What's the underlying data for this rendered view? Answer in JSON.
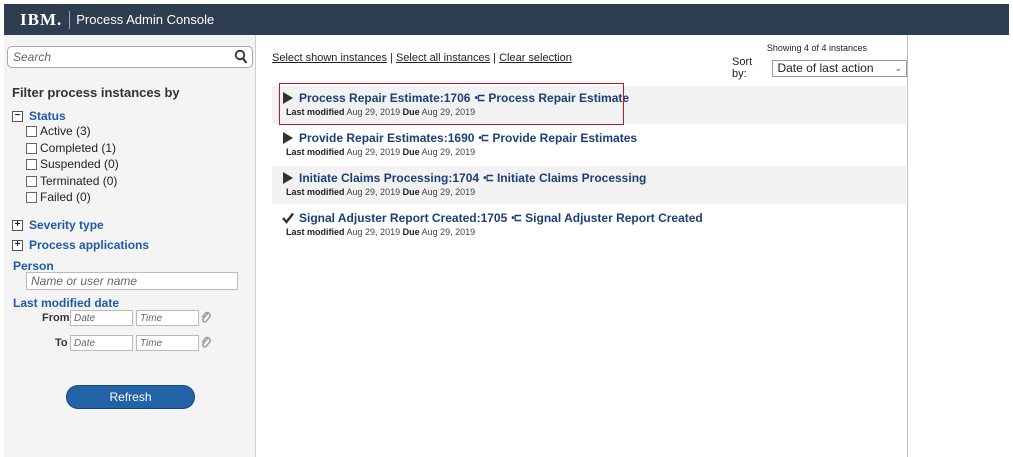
{
  "header": {
    "logo": "IBM.",
    "title": "Process Admin Console"
  },
  "sidebar": {
    "search_placeholder": "Search",
    "filter_title": "Filter process instances by",
    "status": {
      "label": "Status",
      "toggle": "−",
      "options": [
        "Active (3)",
        "Completed (1)",
        "Suspended (0)",
        "Terminated (0)",
        "Failed (0)"
      ]
    },
    "severity": {
      "label": "Severity type",
      "toggle": "+"
    },
    "process_apps": {
      "label": "Process applications",
      "toggle": "+"
    },
    "person": {
      "label": "Person",
      "placeholder": "Name or user name"
    },
    "last_modified": {
      "label": "Last modified date",
      "from_label": "From",
      "to_label": "To",
      "date_placeholder": "Date",
      "time_placeholder": "Time"
    },
    "refresh_label": "Refresh"
  },
  "main": {
    "select_shown": "Select shown instances",
    "select_all": "Select all instances",
    "clear_selection": "Clear selection",
    "separator": "|",
    "showing": "Showing 4 of 4 instances",
    "sort_label": "Sort by:",
    "sort_value": "Date of last action",
    "meta_labels": {
      "last_modified": "Last modified",
      "due": "Due"
    },
    "instances": [
      {
        "name": "Process Repair Estimate:1706",
        "process": "Process Repair Estimate",
        "last_modified": "Aug 29, 2019",
        "due": "Aug 29, 2019",
        "state_icon": "play-icon",
        "highlighted": true
      },
      {
        "name": "Provide Repair Estimates:1690",
        "process": "Provide Repair Estimates",
        "last_modified": "Aug 29, 2019",
        "due": "Aug 29, 2019",
        "state_icon": "play-icon"
      },
      {
        "name": "Initiate Claims Processing:1704",
        "process": "Initiate Claims Processing",
        "last_modified": "Aug 29, 2019",
        "due": "Aug 29, 2019",
        "state_icon": "play-icon"
      },
      {
        "name": "Signal Adjuster Report Created:1705",
        "process": "Signal Adjuster Report Created",
        "last_modified": "Aug 29, 2019",
        "due": "Aug 29, 2019",
        "state_icon": "checkmark-icon"
      }
    ]
  },
  "colors": {
    "header_bg": "#2e3d4f",
    "link_blue": "#1f5aa6",
    "title_blue": "#1c3f78",
    "button_blue": "#2362a6",
    "highlight_red": "#c0152f"
  }
}
